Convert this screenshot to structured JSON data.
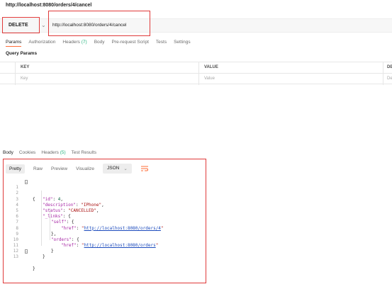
{
  "window": {
    "title": "http://localhost:8080/orders/4/cancel"
  },
  "request": {
    "method": "DELETE",
    "url": "http://localhost:8080/orders/4/cancel"
  },
  "request_tabs": {
    "params": "Params",
    "authorization": "Authorization",
    "headers": "Headers",
    "headers_count": "(7)",
    "body": "Body",
    "pre_request": "Pre-request Script",
    "tests": "Tests",
    "settings": "Settings"
  },
  "query_params": {
    "label": "Query Params",
    "columns": {
      "key": "KEY",
      "value": "VALUE",
      "desc": "DE"
    },
    "placeholder": {
      "key": "Key",
      "value": "Value",
      "desc": "De"
    }
  },
  "response_tabs": {
    "body": "Body",
    "cookies": "Cookies",
    "headers": "Headers",
    "headers_count": "(5)",
    "test_results": "Test Results"
  },
  "view": {
    "pretty": "Pretty",
    "raw": "Raw",
    "preview": "Preview",
    "visualize": "Visualize",
    "format": "JSON"
  },
  "response_json": {
    "line_numbers": [
      "1",
      "2",
      "3",
      "4",
      "5",
      "6",
      "7",
      "8",
      "9",
      "10",
      "11",
      "12",
      "13"
    ],
    "id_key": "\"id\"",
    "id_value": "4",
    "description_key": "\"description\"",
    "description_value": "\"IPhone\"",
    "status_key": "\"status\"",
    "status_value": "\"CANCELLED\"",
    "links_key": "\"_links\"",
    "self_key": "\"self\"",
    "href_key": "\"href\"",
    "self_href": "http://localhost:8080/orders/4",
    "orders_key": "\"orders\"",
    "orders_href": "http://localhost:8080/orders"
  },
  "colors": {
    "accent": "#ff6c37",
    "annotation": "#e03a3a",
    "count": "#26b47f",
    "link": "#1c4bbd"
  }
}
